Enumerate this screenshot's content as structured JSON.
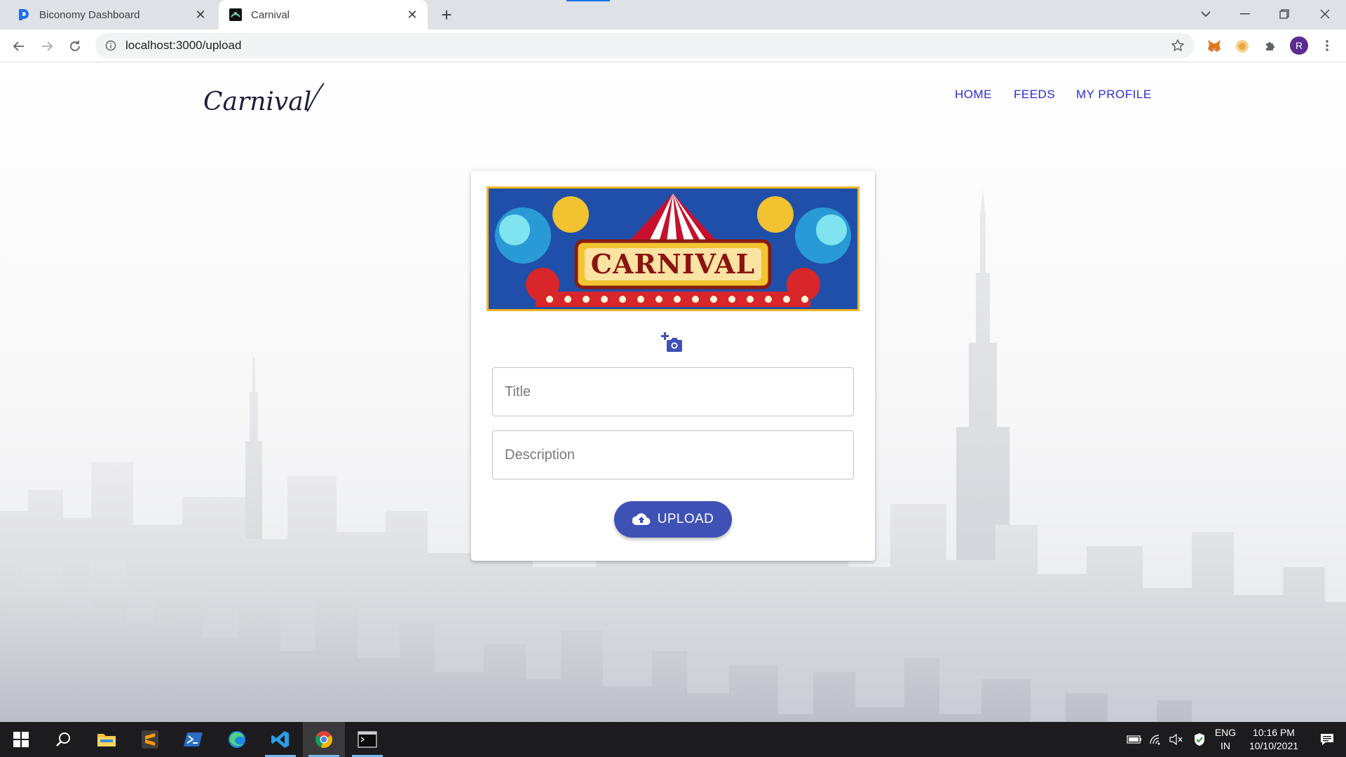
{
  "browser": {
    "tabs": [
      {
        "title": "Biconomy Dashboard",
        "icon": "biconomy-logo-icon",
        "active": false
      },
      {
        "title": "Carnival",
        "icon": "carnival-favicon-icon",
        "active": true
      }
    ],
    "new_tab_label": "+",
    "url": "localhost:3000/upload",
    "profile_initial": "R",
    "accent_color": "#1a73e8"
  },
  "site": {
    "logo_text": "Carnival",
    "nav": [
      "HOME",
      "FEEDS",
      "MY PROFILE"
    ],
    "nav_color": "#2b2bd0"
  },
  "upload_card": {
    "banner_text": "CARNIVAL",
    "camera_icon": "add-photo-icon",
    "title_placeholder": "Title",
    "description_placeholder": "Description",
    "title_value": "",
    "description_value": "",
    "upload_label": "UPLOAD",
    "upload_icon": "cloud-upload-icon",
    "button_color": "#3f51b5"
  },
  "taskbar": {
    "apps": [
      "start-icon",
      "search-icon",
      "file-explorer-icon",
      "sublime-text-icon",
      "powershell-icon",
      "edge-icon",
      "vscode-icon",
      "chrome-icon",
      "terminal-icon"
    ],
    "language": "ENG",
    "region": "IN",
    "time": "10:16 PM",
    "date": "10/10/2021"
  }
}
